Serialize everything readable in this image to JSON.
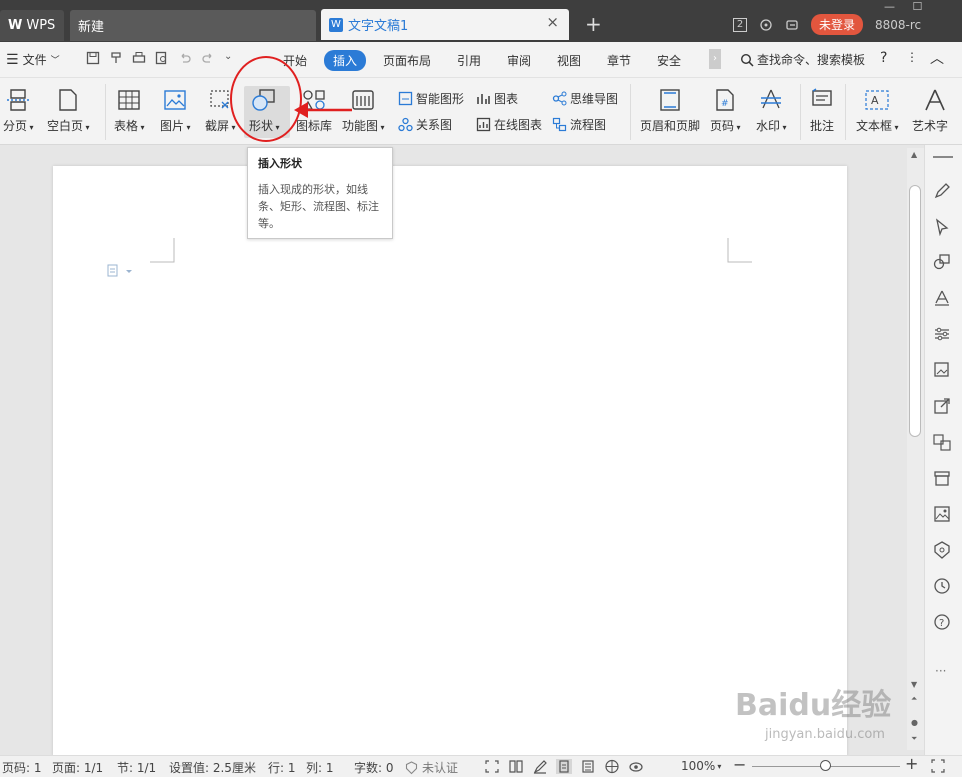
{
  "titlebar": {
    "wps_label": "WPS",
    "new_tab_label": "新建",
    "doc_tab_label": "文字文稿1",
    "doc_close": "×",
    "add_tab": "+",
    "window_count": "2",
    "login_label": "未登录",
    "user_id": "8808-rc"
  },
  "menubar": {
    "file": "文件",
    "items": [
      "开始",
      "插入",
      "页面布局",
      "引用",
      "审阅",
      "视图",
      "章节",
      "安全"
    ],
    "search": "查找命令、搜索模板",
    "help": "?"
  },
  "ribbon": {
    "page_break": "分页",
    "blank_page": "空白页",
    "table": "表格",
    "picture": "图片",
    "screenshot": "截屏",
    "shape": "形状",
    "icon_lib": "图标库",
    "function_chart": "功能图",
    "smart_graphic": "智能图形",
    "chart": "图表",
    "mind_map": "思维导图",
    "relation_map": "关系图",
    "online_chart": "在线图表",
    "flowchart": "流程图",
    "header_footer": "页眉和页脚",
    "page_number": "页码",
    "watermark": "水印",
    "comment": "批注",
    "text_box": "文本框",
    "word_art": "艺术字"
  },
  "tooltip": {
    "title": "插入形状",
    "body": "插入现成的形状，如线条、矩形、流程图、标注等。"
  },
  "status": {
    "page_num": "页码: 1",
    "pages": "页面: 1/1",
    "section": "节: 1/1",
    "setting": "设置值: 2.5厘米",
    "row": "行: 1",
    "col": "列: 1",
    "word_count": "字数: 0",
    "auth": "未认证",
    "zoom": "100%"
  },
  "watermark": {
    "brand": "Baidu经验",
    "url": "jingyan.baidu.com"
  },
  "colors": {
    "accent": "#2b7bd6",
    "login": "#e2563e",
    "highlight_circle": "#e02020"
  }
}
